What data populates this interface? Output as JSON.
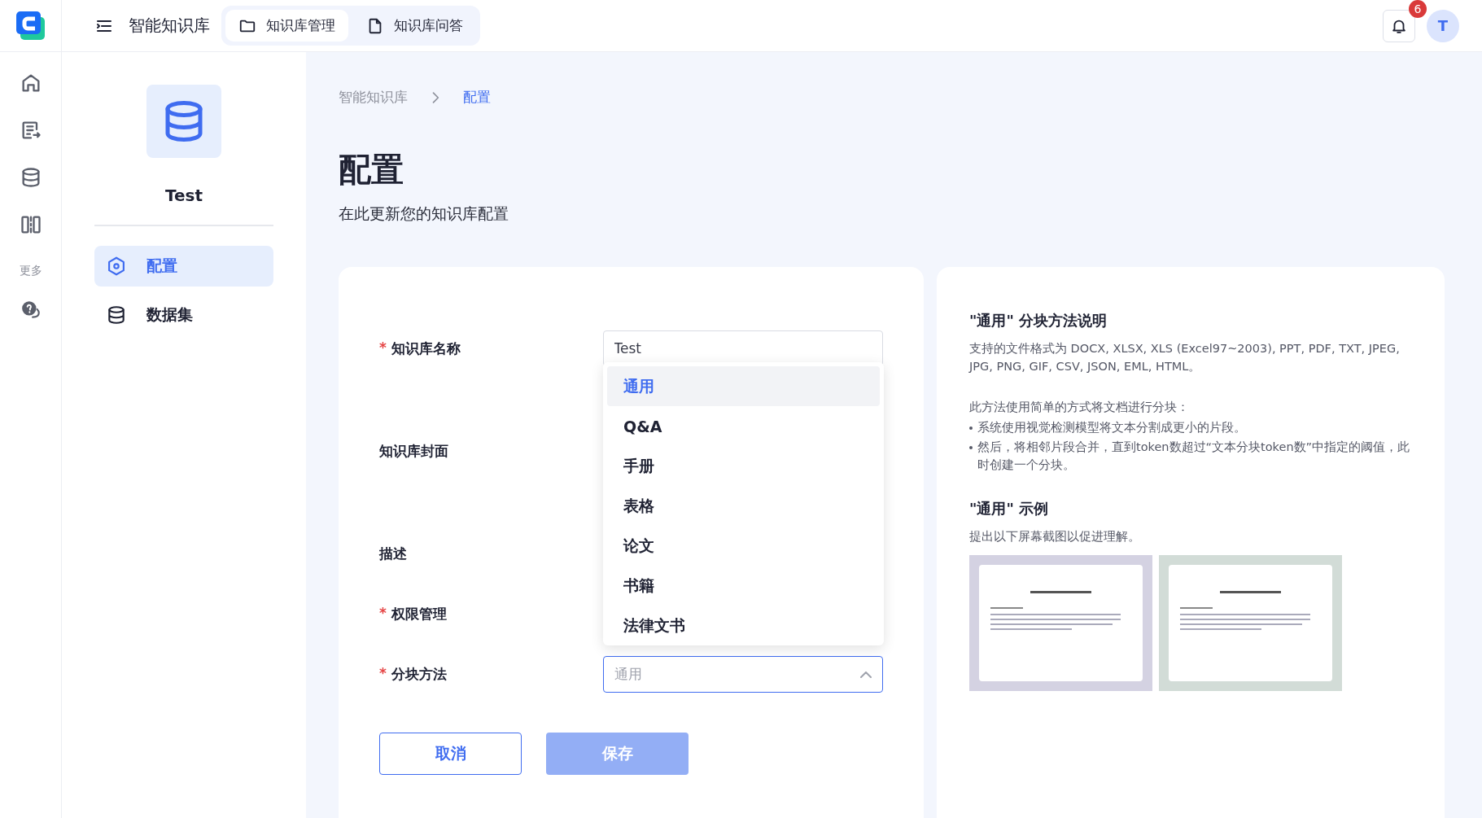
{
  "topbar": {
    "title": "智能知识库",
    "tabs": [
      {
        "label": "知识库管理",
        "selected": true
      },
      {
        "label": "知识库问答",
        "selected": false
      }
    ],
    "notifications": "6",
    "avatar": "T"
  },
  "rail": {
    "items": [
      {
        "selected": false
      },
      {
        "selected": false
      },
      {
        "selected": false
      },
      {
        "selected": false
      }
    ],
    "more_label": "更多"
  },
  "kb": {
    "name": "Test",
    "nav": [
      {
        "label": "配置",
        "selected": true
      },
      {
        "label": "数据集",
        "selected": false
      }
    ]
  },
  "breadcrumb": [
    "智能知识库",
    "配置"
  ],
  "page": {
    "title": "配置",
    "subtitle": "在此更新您的知识库配置"
  },
  "form": {
    "fields": [
      {
        "label": "知识库名称",
        "required_mark": "*",
        "kind": "text",
        "value": "Test"
      },
      {
        "label": "知识库封面",
        "kind": "hidden"
      },
      {
        "label": "描述",
        "kind": "hidden"
      },
      {
        "label": "权限管理",
        "required_mark": "*",
        "kind": "hidden"
      },
      {
        "label": "分块方法",
        "required_mark": "*",
        "kind": "select",
        "value": "通用",
        "open": true
      }
    ],
    "options": [
      {
        "label": "通用",
        "selected": true
      },
      {
        "label": "Q&A",
        "selected": false
      },
      {
        "label": "手册",
        "selected": false
      },
      {
        "label": "表格",
        "selected": false
      },
      {
        "label": "论文",
        "selected": false
      },
      {
        "label": "书籍",
        "selected": false
      },
      {
        "label": "法律文书",
        "selected": false
      }
    ],
    "cancel": "取消",
    "save": "保存",
    "save_disabled": true
  },
  "help": {
    "title": "\"通用\" 分块方法说明",
    "formats": "支持的文件格式为 DOCX, XLSX, XLS (Excel97~2003), PPT, PDF, TXT, JPEG, JPG, PNG, GIF, CSV, JSON, EML, HTML。",
    "intro": "此方法使用简单的方式将文档进行分块：",
    "bullets": [
      "系统使用视觉检测模型将文本分割成更小的片段。",
      "然后，将相邻片段合并，直到token数超过“文本分块token数”中指定的阈值，此时创建一个分块。"
    ],
    "example_title": "\"通用\" 示例",
    "example_text": "提出以下屏幕截图以促进理解。"
  }
}
